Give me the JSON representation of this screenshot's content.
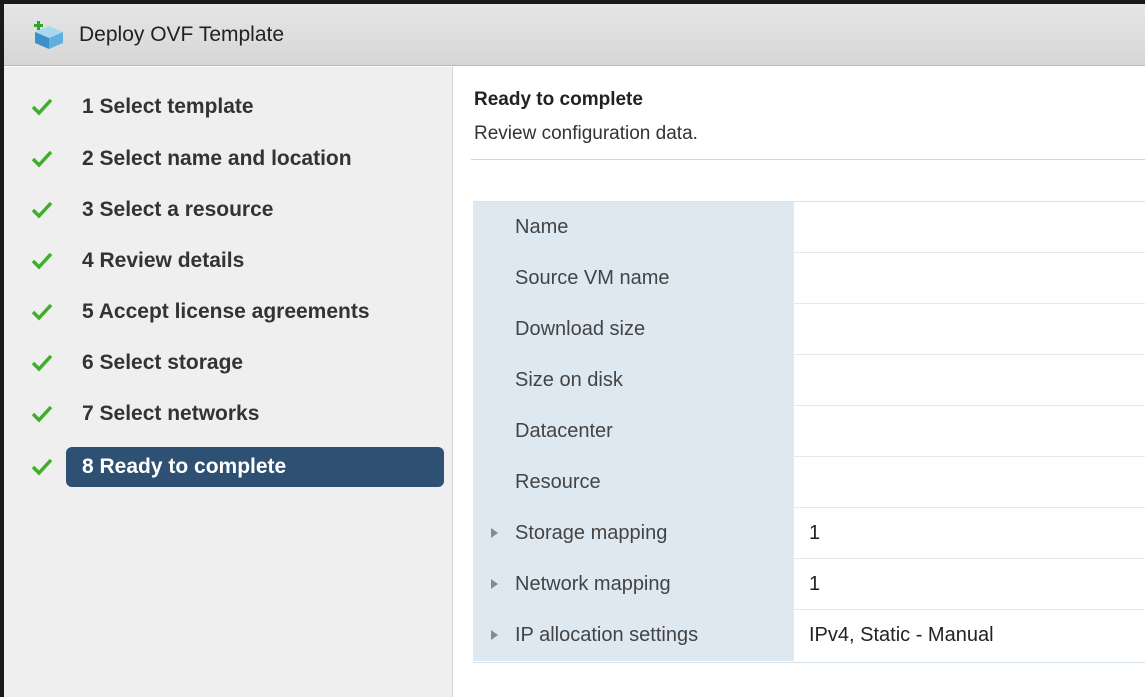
{
  "window": {
    "title": "Deploy OVF Template",
    "icon": "ovf-template-cube-icon"
  },
  "sidebar": {
    "steps": [
      {
        "label": "1  Select template",
        "done": true
      },
      {
        "label": "2  Select name and location",
        "done": true
      },
      {
        "label": "3  Select a resource",
        "done": true
      },
      {
        "label": "4  Review details",
        "done": true
      },
      {
        "label": "5  Accept license agreements",
        "done": true
      },
      {
        "label": "6  Select storage",
        "done": true
      },
      {
        "label": "7  Select networks",
        "done": true
      },
      {
        "label": "8  Ready to complete",
        "done": true,
        "active": true
      }
    ]
  },
  "main": {
    "title": "Ready to complete",
    "subtitle": "Review configuration data.",
    "rows": [
      {
        "key": "Name",
        "value": "",
        "expandable": false
      },
      {
        "key": "Source VM name",
        "value": "",
        "expandable": false
      },
      {
        "key": "Download size",
        "value": "",
        "expandable": false
      },
      {
        "key": "Size on disk",
        "value": "",
        "expandable": false
      },
      {
        "key": "Datacenter",
        "value": "",
        "expandable": false
      },
      {
        "key": "Resource",
        "value": "",
        "expandable": false
      },
      {
        "key": "Storage mapping",
        "value": "1",
        "expandable": true
      },
      {
        "key": "Network mapping",
        "value": "1",
        "expandable": true
      },
      {
        "key": "IP allocation settings",
        "value": "IPv4, Static - Manual",
        "expandable": true
      }
    ]
  },
  "colors": {
    "check": "#3fae29",
    "active_step_bg": "#2d5073",
    "key_cell_bg": "#dde8f1"
  }
}
